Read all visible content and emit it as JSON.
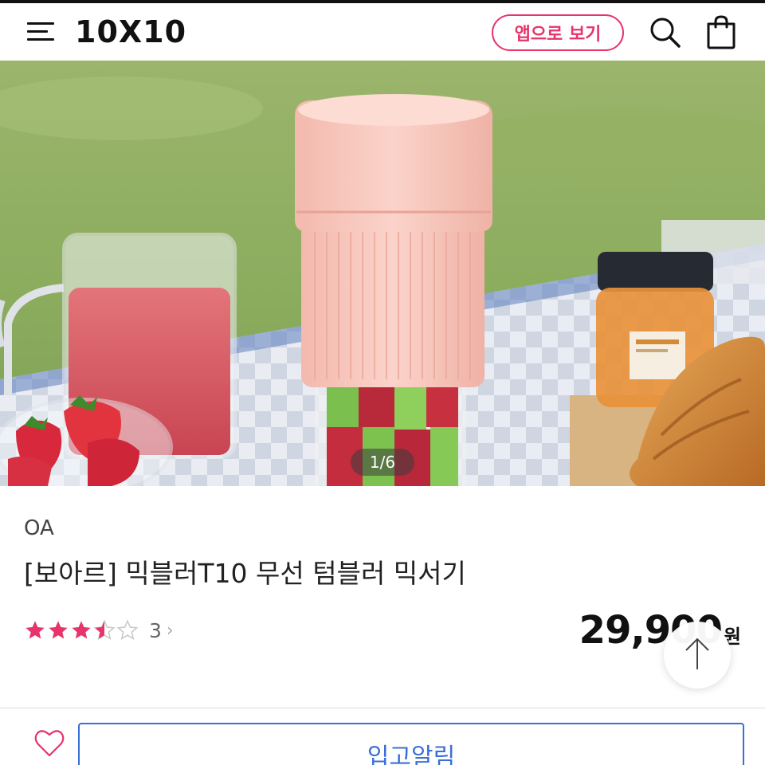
{
  "header": {
    "logo": "10X10",
    "app_button_label": "앱으로 보기",
    "icons": [
      "menu-icon",
      "search-icon",
      "shopping-bag-icon"
    ]
  },
  "gallery": {
    "counter": "1/6"
  },
  "product": {
    "brand": "OA",
    "title": "[보아르] 믹블러T10 무선 텀블러 믹서기",
    "rating": 3.5,
    "rating_max": 5,
    "review_count": "3",
    "price": "29,900",
    "price_unit": "원"
  },
  "bottom_bar": {
    "notify_label": "입고알림"
  },
  "colors": {
    "accent_pink": "#e8336b",
    "star": "#e8336b",
    "notify_blue": "#3a6fd9"
  }
}
